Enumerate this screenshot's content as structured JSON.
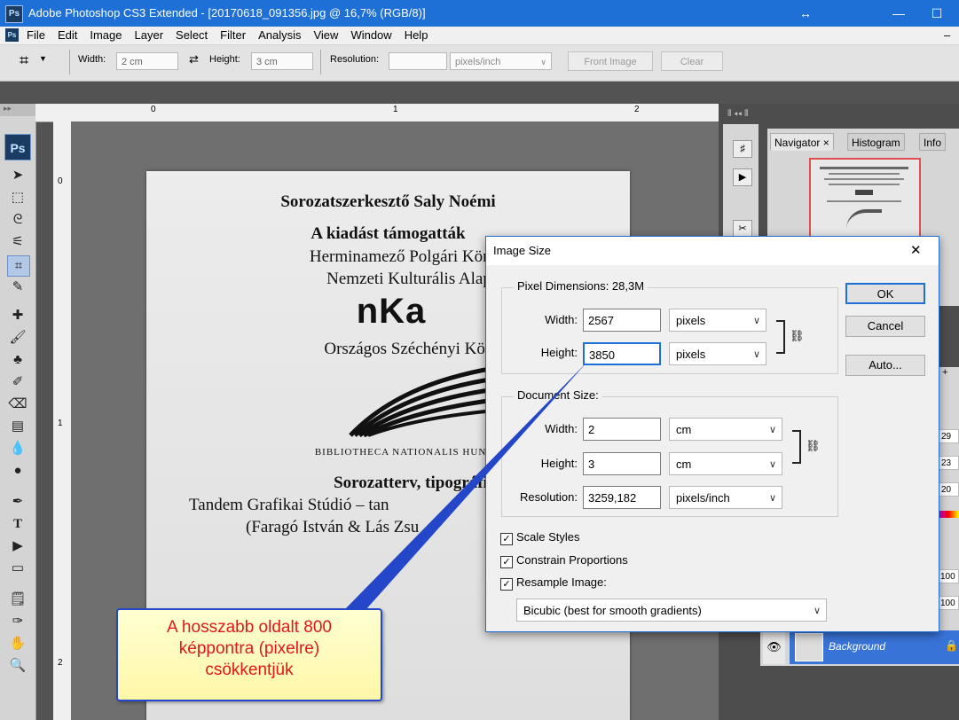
{
  "window": {
    "title": "Adobe Photoshop CS3 Extended - [20170618_091356.jpg @ 16,7% (RGB/8)]",
    "app_icon": "Ps",
    "controls": {
      "restore": "↔",
      "minimize": "—",
      "maximize": "☐"
    }
  },
  "menubar": {
    "items": [
      "File",
      "Edit",
      "Image",
      "Layer",
      "Select",
      "Filter",
      "Analysis",
      "View",
      "Window",
      "Help"
    ]
  },
  "options": {
    "width_label": "Width:",
    "width_value": "2 cm",
    "height_label": "Height:",
    "height_value": "3 cm",
    "resolution_label": "Resolution:",
    "resolution_value": "",
    "unit": "pixels/inch",
    "front_image": "Front Image",
    "clear": "Clear"
  },
  "rulers": {
    "top": [
      "0",
      "1",
      "2"
    ],
    "left": [
      "0",
      "1",
      "2"
    ]
  },
  "document": {
    "line1": "Sorozatszerkesztő Saly Noémi",
    "line2": "A kiadást támogatták",
    "line3": "Herminamező Polgári Köre –",
    "line4": "Nemzeti Kulturális Alap",
    "logo": "nKa",
    "line5": "Országos Széchényi Könyvt",
    "line6": "BIBLIOTHECA NATIONALIS HUNGARI",
    "line7": "Sorozatterv, tipográfi",
    "line8": "Tandem Grafikai Stúdió – tan",
    "line9": "(Faragó István & Lás  Zsu"
  },
  "panels": {
    "tabs": [
      "Navigator ×",
      "Histogram",
      "Info"
    ],
    "layer_name": "Background",
    "side_values": [
      "29",
      "23",
      "20",
      "100",
      "100"
    ]
  },
  "dialog": {
    "title": "Image Size",
    "close": "✕",
    "pixel_group": "Pixel Dimensions:  28,3M",
    "px_width_label": "Width:",
    "px_width_value": "2567",
    "px_width_unit": "pixels",
    "px_height_label": "Height:",
    "px_height_value": "3850",
    "px_height_unit": "pixels",
    "doc_group": "Document Size:",
    "doc_width_label": "Width:",
    "doc_width_value": "2",
    "doc_width_unit": "cm",
    "doc_height_label": "Height:",
    "doc_height_value": "3",
    "doc_height_unit": "cm",
    "res_label": "Resolution:",
    "res_value": "3259,182",
    "res_unit": "pixels/inch",
    "ok": "OK",
    "cancel": "Cancel",
    "auto": "Auto...",
    "scale_styles": "Scale Styles",
    "constrain": "Constrain Proportions",
    "resample": "Resample Image:",
    "resample_method": "Bicubic (best for smooth gradients)",
    "scale_styles_checked": true,
    "constrain_checked": true,
    "resample_checked": true
  },
  "callout": {
    "line1": "A hosszabb oldalt 800",
    "line2": "képpontra (pixelre)",
    "line3": "csökkentjük",
    "text_color": "#e0161d",
    "border_color": "#2446c8"
  }
}
